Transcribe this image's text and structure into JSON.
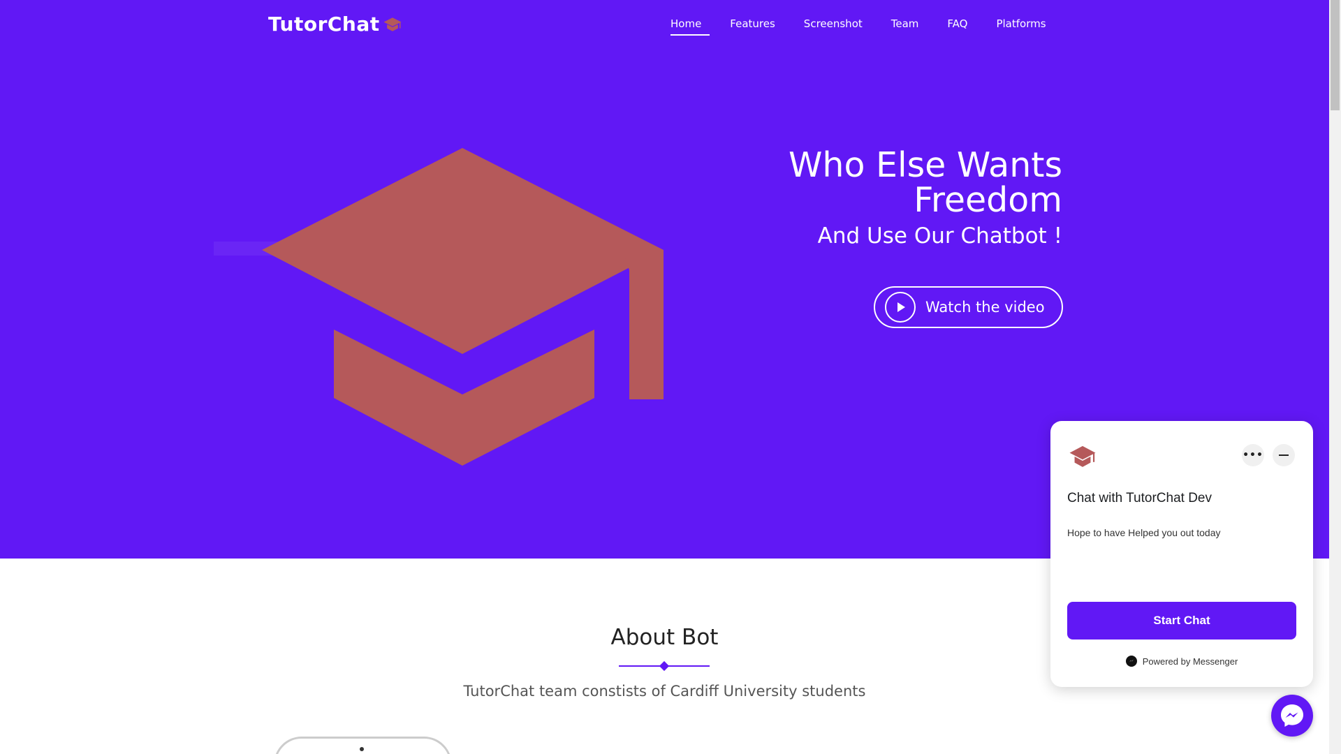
{
  "nav": {
    "brand": "TutorChat",
    "brand_icon": "graduation-cap-icon",
    "links": [
      "Home",
      "Features",
      "Screenshot",
      "Team",
      "FAQ",
      "Platforms"
    ],
    "active": "Home"
  },
  "hero": {
    "title": "Who Else Wants Freedom",
    "subtitle": "And Use Our Chatbot !",
    "watch_label": "Watch the video",
    "image_icon": "graduation-cap-icon"
  },
  "about": {
    "title": "About Bot",
    "text": "TutorChat team constists of Cardiff University students"
  },
  "chat": {
    "title": "Chat with TutorChat Dev",
    "message": "Hope to have Helped you out today",
    "button": "Start Chat",
    "powered": "Powered by Messenger"
  },
  "colors": {
    "brand": "#6118f5",
    "cap": "#b5595a",
    "white": "#ffffff"
  }
}
